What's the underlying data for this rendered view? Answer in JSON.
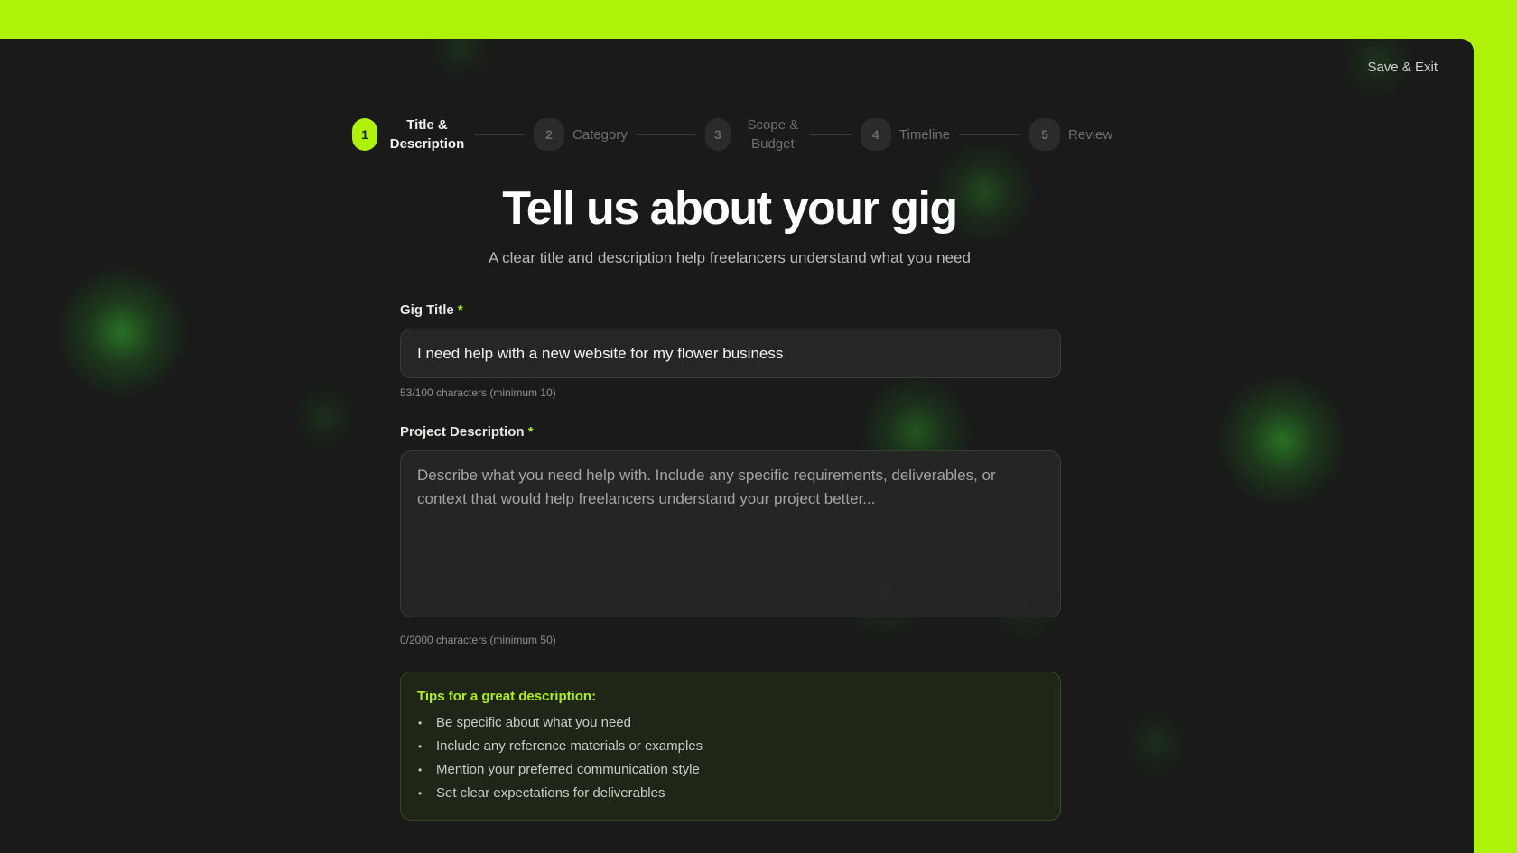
{
  "header": {
    "save_exit_label": "Save & Exit"
  },
  "stepper": {
    "steps": [
      {
        "number": "1",
        "label": "Title & Description",
        "active": true
      },
      {
        "number": "2",
        "label": "Category",
        "active": false
      },
      {
        "number": "3",
        "label": "Scope & Budget",
        "active": false
      },
      {
        "number": "4",
        "label": "Timeline",
        "active": false
      },
      {
        "number": "5",
        "label": "Review",
        "active": false
      }
    ]
  },
  "main": {
    "title": "Tell us about your gig",
    "subtitle": "A clear title and description help freelancers understand what you need"
  },
  "form": {
    "gig_title": {
      "label": "Gig Title",
      "required_mark": "*",
      "value": "I need help with a new website for my flower business",
      "counter": "53/100 characters (minimum 10)"
    },
    "description": {
      "label": "Project Description",
      "required_mark": "*",
      "value": "",
      "placeholder": "Describe what you need help with. Include any specific requirements, deliverables, or context that would help freelancers understand your project better...",
      "counter": "0/2000 characters (minimum 50)"
    }
  },
  "tips": {
    "title": "Tips for a great description:",
    "items": [
      "Be specific about what you need",
      "Include any reference materials or examples",
      "Mention your preferred communication style",
      "Set clear expectations for deliverables"
    ]
  },
  "colors": {
    "accent": "#aef20a",
    "background": "#191a19",
    "frame": "#aef20a"
  }
}
